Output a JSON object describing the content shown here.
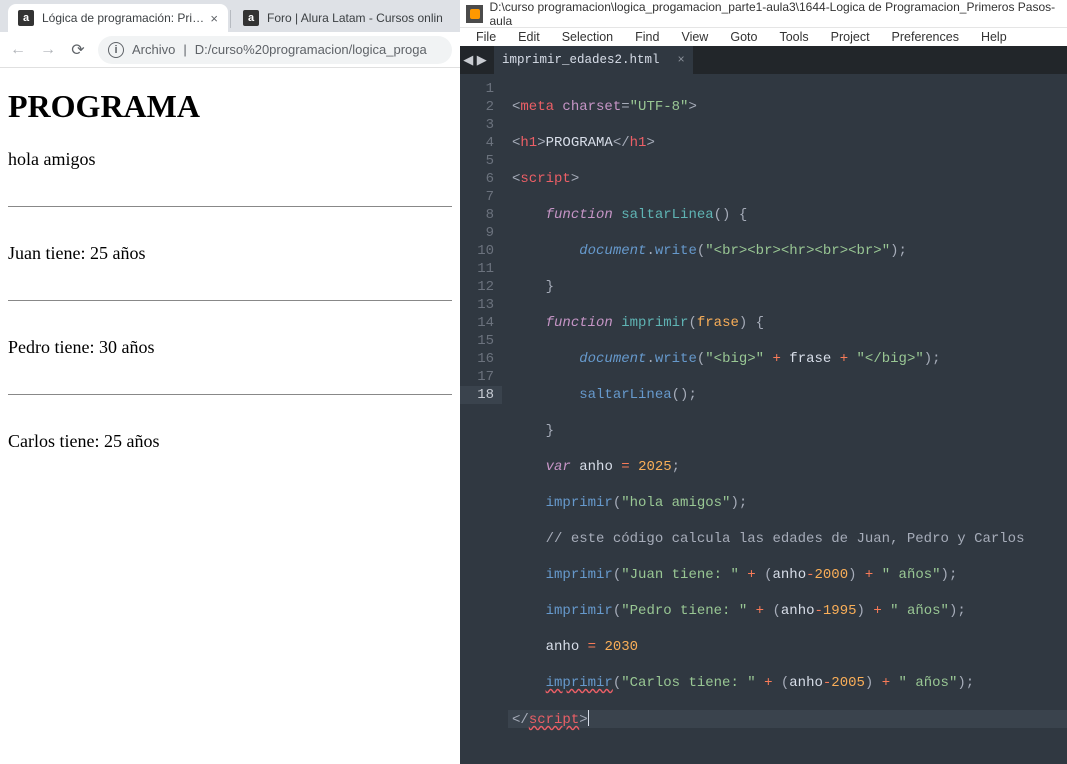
{
  "browser": {
    "tabs": [
      {
        "label": "Lógica de programación: Primero"
      },
      {
        "label": "Foro | Alura Latam - Cursos onlin"
      }
    ],
    "addr_label": "Archivo",
    "addr_path": "D:/curso%20programacion/logica_proga"
  },
  "page": {
    "heading": "PROGRAMA",
    "lines": [
      "hola amigos",
      "Juan tiene: 25 años",
      "Pedro tiene: 30 años",
      "Carlos tiene: 25 años"
    ]
  },
  "sublime": {
    "title": "D:\\curso programacion\\logica_progamacion_parte1-aula3\\1644-Logica de Programacion_Primeros Pasos-aula",
    "menu": [
      "File",
      "Edit",
      "Selection",
      "Find",
      "View",
      "Goto",
      "Tools",
      "Project",
      "Preferences",
      "Help"
    ],
    "tab": "imprimir_edades2.html",
    "lines": 18,
    "tokens": {
      "l1": {
        "attr": "charset",
        "val": "\"UTF-8\""
      },
      "l2": {
        "txt": "PROGRAMA"
      },
      "l4": {
        "fname": "saltarLinea"
      },
      "l5": {
        "str": "\"<br><br><hr><br><br>\""
      },
      "l7": {
        "fname": "imprimir",
        "param": "frase"
      },
      "l8": {
        "s1": "\"<big>\"",
        "var": "frase",
        "s2": "\"</big>\""
      },
      "l9": {
        "call": "saltarLinea"
      },
      "l11": {
        "var": "anho",
        "num": "2025"
      },
      "l12": {
        "call": "imprimir",
        "str": "\"hola amigos\""
      },
      "l13": {
        "comment": "// este código calcula las edades de Juan, Pedro y Carlos"
      },
      "l14": {
        "call": "imprimir",
        "s1": "\"Juan tiene: \"",
        "v": "anho",
        "n": "2000",
        "s2": "\" años\""
      },
      "l15": {
        "call": "imprimir",
        "s1": "\"Pedro tiene: \"",
        "v": "anho",
        "n": "1995",
        "s2": "\" años\""
      },
      "l16": {
        "var": "anho",
        "num": "2030"
      },
      "l17": {
        "call": "imprimir",
        "s1": "\"Carlos tiene: \"",
        "v": "anho",
        "n": "2005",
        "s2": "\" años\""
      }
    }
  }
}
